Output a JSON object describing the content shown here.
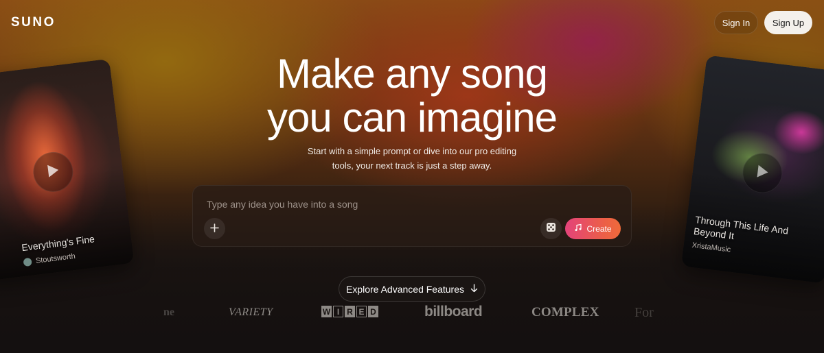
{
  "header": {
    "logo": "SUNO",
    "sign_in_label": "Sign In",
    "sign_up_label": "Sign Up"
  },
  "hero": {
    "title_line1": "Make any song",
    "title_line2": "you can imagine",
    "subtitle_line1": "Start with a simple prompt or dive into our pro editing",
    "subtitle_line2": "tools, your next track is just a step away."
  },
  "prompt": {
    "placeholder": "Type any idea you have into a song",
    "value": "",
    "add_icon": "plus-icon",
    "dice_icon": "dice-icon",
    "create_icon": "music-note-sparkle-icon",
    "create_label": "Create"
  },
  "explore": {
    "label": "Explore Advanced Features",
    "icon": "arrow-down-icon"
  },
  "press": {
    "logo_1": "ne",
    "logo_2": "VARIETY",
    "logo_3": "WIRED",
    "logo_4": "billboard",
    "logo_5": "COMPLEX",
    "logo_6": "For"
  },
  "cards": {
    "left": {
      "title": "Everything's Fine",
      "artist": "Stoutsworth",
      "play_icon": "play-icon"
    },
    "right": {
      "title": "Through This Life And Beyond It",
      "artist": "XristaMusic",
      "play_icon": "play-icon"
    }
  },
  "colors": {
    "accent_gradient_start": "#e3437a",
    "accent_gradient_end": "#ef6a3a",
    "sign_up_bg": "#f4f1ec"
  }
}
